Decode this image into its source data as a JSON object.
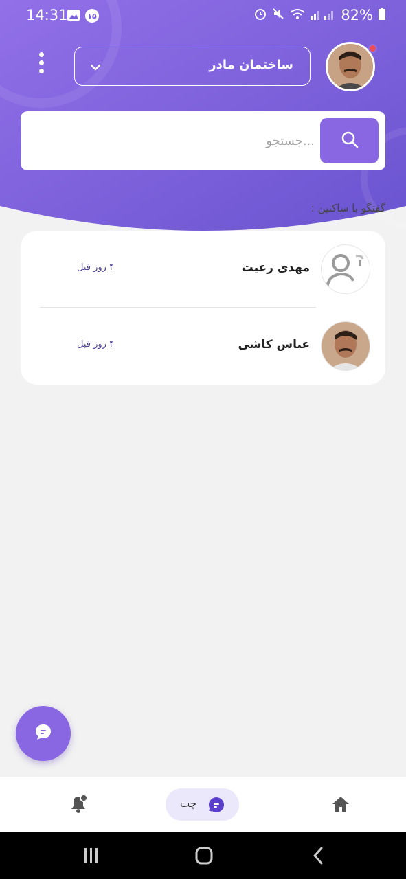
{
  "status_bar": {
    "time": "14:31",
    "notification_badge": "۱۵",
    "battery": "82%"
  },
  "header": {
    "building_name": "ساختمان مادر",
    "search_placeholder": "...جستجو"
  },
  "section": {
    "title": "گفتگو با ساکنین :"
  },
  "chats": [
    {
      "name": "مهدی رعیت",
      "time": "۴ روز قبل",
      "avatar": "default-user"
    },
    {
      "name": "عباس کاشی",
      "time": "۴ روز قبل",
      "avatar": "photo"
    }
  ],
  "bottom_nav": {
    "chat_label": "چت",
    "items": [
      "home-icon",
      "chat-icon",
      "bell-icon"
    ]
  },
  "colors": {
    "primary": "#8a67e2",
    "header_gradient_start": "#8e6ee6",
    "header_gradient_end": "#6f55d4",
    "badge_red": "#e94b5a"
  }
}
